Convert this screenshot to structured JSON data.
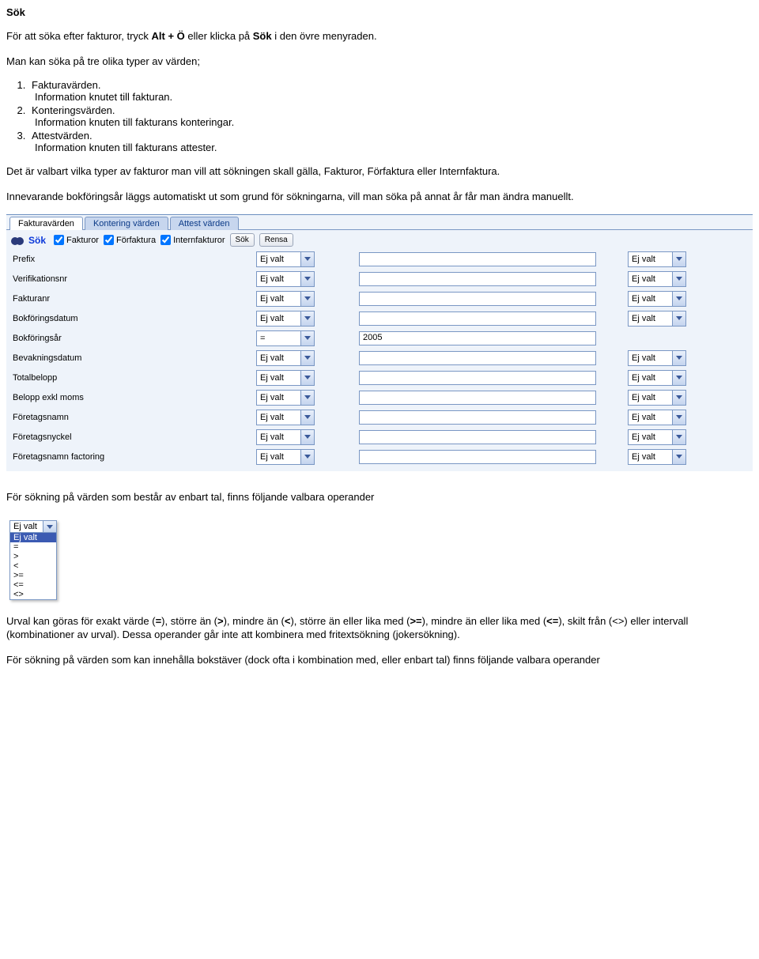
{
  "doc": {
    "heading": "Sök",
    "intro_p1_a": "För att söka efter fakturor, tryck ",
    "intro_p1_b": "Alt + Ö",
    "intro_p1_c": " eller klicka på ",
    "intro_p1_d": "Sök",
    "intro_p1_e": " i den övre menyraden.",
    "intro_p2": "Man kan söka på tre olika typer av värden;",
    "list": [
      {
        "t": "Fakturavärden.",
        "s": "Information knutet till fakturan."
      },
      {
        "t": "Konteringsvärden.",
        "s": "Information knuten till fakturans konteringar."
      },
      {
        "t": "Attestvärden.",
        "s": "Information knuten till fakturans attester."
      }
    ],
    "p3": "Det är valbart vilka typer av fakturor man vill att sökningen skall gälla, Fakturor, Förfaktura eller Internfaktura.",
    "p4": "Innevarande bokföringsår läggs automatiskt ut som grund för sökningarna, vill man söka på annat år får man ändra manuellt.",
    "p5": "För sökning på värden som består av enbart tal, finns följande valbara operander",
    "p6_a": "Urval kan göras för exakt värde (",
    "p6_b": "=",
    "p6_c": "), större än (",
    "p6_d": ">",
    "p6_e": "), mindre än (",
    "p6_f": "<",
    "p6_g": "), större än eller lika med (",
    "p6_h": ">=",
    "p6_i": "), mindre än eller lika med (",
    "p6_j": "<=",
    "p6_k": "), skilt från (<>) eller intervall (kombinationer av urval). Dessa operander går inte att kombinera med fritextsökning (jokersökning).",
    "p7": "För sökning på värden som kan innehålla bokstäver (dock ofta i kombination med, eller enbart tal) finns följande valbara operander"
  },
  "ui": {
    "tabs": [
      "Fakturavärden",
      "Kontering värden",
      "Attest värden"
    ],
    "active_tab": 0,
    "sok_label": "Sök",
    "checks": [
      {
        "label": "Fakturor",
        "checked": true
      },
      {
        "label": "Förfaktura",
        "checked": true
      },
      {
        "label": "Internfakturor",
        "checked": true
      }
    ],
    "btn_sok": "Sök",
    "btn_rensa": "Rensa",
    "rows": [
      {
        "label": "Prefix",
        "op1": "Ej valt",
        "val": "",
        "op2": "Ej valt",
        "has_op2": true
      },
      {
        "label": "Verifikationsnr",
        "op1": "Ej valt",
        "val": "",
        "op2": "Ej valt",
        "has_op2": true
      },
      {
        "label": "Fakturanr",
        "op1": "Ej valt",
        "val": "",
        "op2": "Ej valt",
        "has_op2": true
      },
      {
        "label": "Bokföringsdatum",
        "op1": "Ej valt",
        "val": "",
        "op2": "Ej valt",
        "has_op2": true
      },
      {
        "label": "Bokföringsår",
        "op1": "=",
        "val": "2005",
        "op2": "",
        "has_op2": false
      },
      {
        "label": "Bevakningsdatum",
        "op1": "Ej valt",
        "val": "",
        "op2": "Ej valt",
        "has_op2": true
      },
      {
        "label": "Totalbelopp",
        "op1": "Ej valt",
        "val": "",
        "op2": "Ej valt",
        "has_op2": true
      },
      {
        "label": "Belopp exkl moms",
        "op1": "Ej valt",
        "val": "",
        "op2": "Ej valt",
        "has_op2": true
      },
      {
        "label": "Företagsnamn",
        "op1": "Ej valt",
        "val": "",
        "op2": "Ej valt",
        "has_op2": true
      },
      {
        "label": "Företagsnyckel",
        "op1": "Ej valt",
        "val": "",
        "op2": "Ej valt",
        "has_op2": true
      },
      {
        "label": "Företagsnamn factoring",
        "op1": "Ej valt",
        "val": "",
        "op2": "Ej valt",
        "has_op2": true
      }
    ]
  },
  "oplist": {
    "top": "Ej valt",
    "items": [
      "Ej valt",
      "=",
      ">",
      "<",
      ">=",
      "<=",
      "<>"
    ],
    "hl_index": 0
  }
}
